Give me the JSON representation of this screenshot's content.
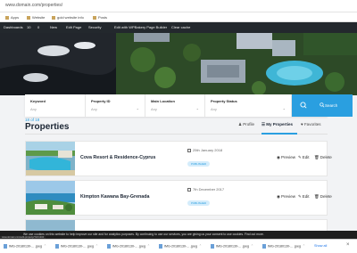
{
  "browser": {
    "url": "www.domain.com/properties/",
    "bookmarks": [
      "Apps",
      "Website",
      "gold website info",
      "Posts"
    ]
  },
  "adminbar": {
    "items": [
      "Dashboards",
      "10",
      "0",
      "New",
      "Edit Page",
      "Security",
      "Edit with WPBakery Page Builder",
      "Clear cache"
    ]
  },
  "search": {
    "fields": [
      {
        "label": "Keyword",
        "value": "Any"
      },
      {
        "label": "Property ID",
        "value": "Any"
      },
      {
        "label": "Main Location",
        "value": "Any"
      },
      {
        "label": "Property Status",
        "value": "Any"
      }
    ],
    "button_label": "Search"
  },
  "listing": {
    "count": "18 of 18",
    "title": "Properties",
    "tabs": [
      "Profile",
      "My Properties",
      "Favorites"
    ],
    "active_tab": "My Properties"
  },
  "properties": [
    {
      "title": "Cova Resort & Residence-Cyprus",
      "date": "25th January 2018",
      "status": "PUBLISHED",
      "actions": [
        "Preview",
        "Edit",
        "Delete"
      ]
    },
    {
      "title": "Kimpton Kawana Bay-Grenada",
      "date": "7th December 2017",
      "status": "PUBLISHED",
      "actions": [
        "Preview",
        "Edit",
        "Delete"
      ]
    }
  ],
  "cookie_bar": {
    "text": "We use cookies on this website to help improve our site and for analytics purposes. By continuing to use our services, you are giving us your consent to use cookies. Find out more.",
    "status_url": "www.domain.com/edit-property/?id=1234"
  },
  "downloads": {
    "files": [
      "IMG-20180130-... .jpeg",
      "IMG-20180130-... .jpeg",
      "IMG-20180130-... .jpeg",
      "IMG-20180130-... .jpeg",
      "IMG-20180130-... .jpeg",
      "IMG-20180130-... .jpeg"
    ],
    "show_all": "Show all"
  },
  "colors": {
    "accent": "#2a9fe0",
    "adminbar": "#23282d"
  }
}
